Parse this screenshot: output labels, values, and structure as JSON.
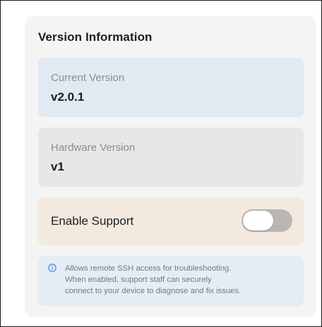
{
  "section": {
    "title": "Version Information"
  },
  "current_version": {
    "label": "Current Version",
    "value": "v2.0.1"
  },
  "hardware_version": {
    "label": "Hardware Version",
    "value": "v1"
  },
  "support": {
    "label": "Enable Support",
    "enabled": false
  },
  "info": {
    "icon": "info-circle-icon",
    "lines": [
      "Allows remote SSH access for troubleshooting.",
      "When enabled, support staff can securely",
      "connect to your device to diagnose and fix issues."
    ]
  },
  "colors": {
    "current_tile": "#e1e9f3",
    "hardware_tile": "#e7e7e7",
    "support_tile": "#f3e9df",
    "info_tile": "#e6ecf4",
    "toggle_off": "#b9b6b3",
    "info_icon": "#3b7ddd"
  }
}
